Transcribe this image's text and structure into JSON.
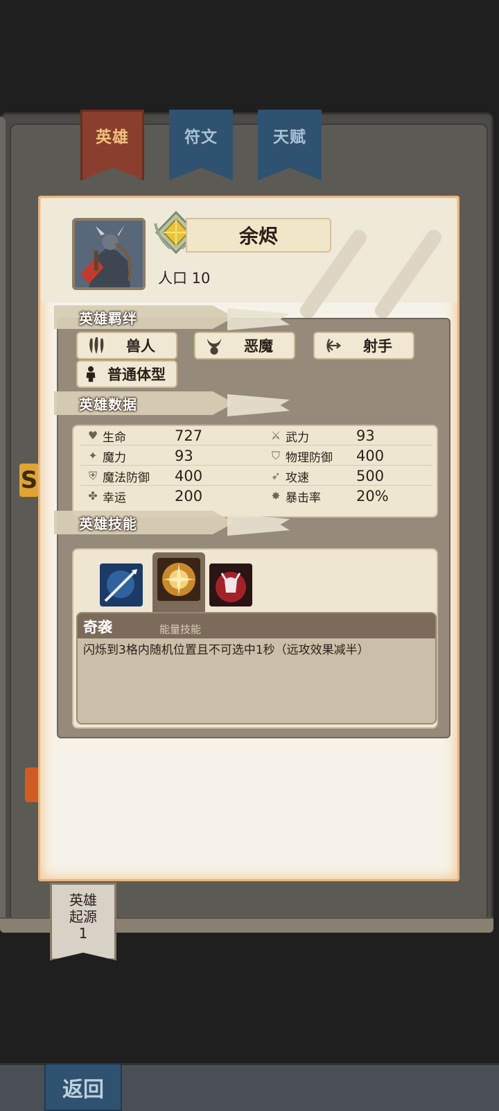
{
  "tabs": [
    {
      "label": "英雄",
      "active": true
    },
    {
      "label": "符文",
      "active": false
    },
    {
      "label": "天赋",
      "active": false
    }
  ],
  "hero": {
    "name": "余烬",
    "population": "人口 10"
  },
  "sections": {
    "bonds": "英雄羁绊",
    "stats": "英雄数据",
    "skills": "英雄技能"
  },
  "traits": [
    {
      "label": "兽人",
      "icon": "claw-icon"
    },
    {
      "label": "恶魔",
      "icon": "demon-horns-icon"
    },
    {
      "label": "射手",
      "icon": "bow-icon"
    },
    {
      "label": "普通体型",
      "icon": "person-icon"
    }
  ],
  "stats": [
    {
      "left_name": "生命",
      "left_value": "727",
      "right_name": "武力",
      "right_value": "93"
    },
    {
      "left_name": "魔力",
      "left_value": "93",
      "right_name": "物理防御",
      "right_value": "400"
    },
    {
      "left_name": "魔法防御",
      "left_value": "400",
      "right_name": "攻速",
      "right_value": "500"
    },
    {
      "left_name": "幸运",
      "left_value": "200",
      "right_name": "暴击率",
      "right_value": "20%"
    }
  ],
  "skill": {
    "name": "奇袭",
    "type": "能量技能",
    "description": "闪烁到3格内随机位置且不可选中1秒（远攻效果减半）"
  },
  "origin": {
    "line1": "英雄",
    "line2": "起源",
    "count": "1"
  },
  "back_label": "返回",
  "colors": {
    "active_tab": "#8a3f2e",
    "inactive_tab": "#2f5270",
    "paper": "#f6f2e7",
    "panel": "#968a7b"
  }
}
